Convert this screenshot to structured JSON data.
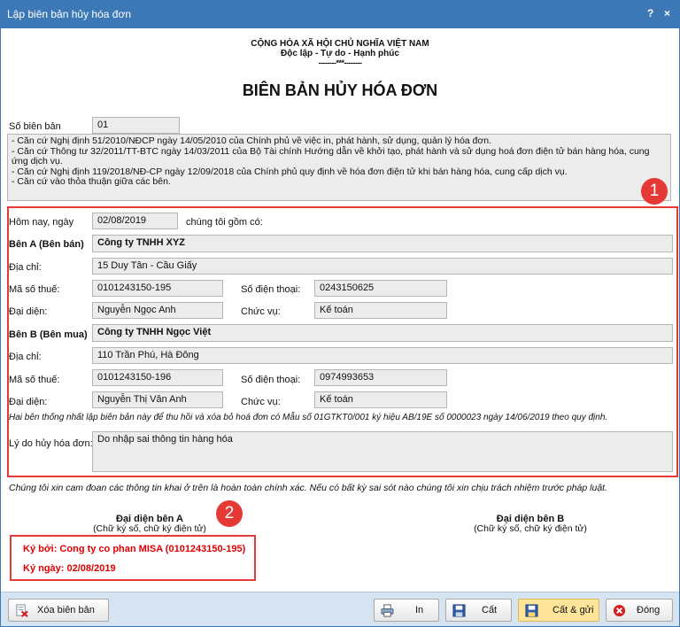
{
  "window": {
    "title": "Lập biên bản hủy hóa đơn",
    "help": "?",
    "close": "×"
  },
  "header": {
    "line1": "CỘNG HÒA XÃ HỘI CHỦ NGHĨA VIỆT NAM",
    "line2": "Độc lập - Tự do - Hạnh phúc",
    "line3": "--------***--------",
    "title": "BIÊN BẢN HỦY HÓA ĐƠN"
  },
  "so_bien_ban": {
    "label": "Số biên bản",
    "value": "01"
  },
  "legal_basis": [
    "- Căn cứ Nghị định 51/2010/NĐCP ngày 14/05/2010 của Chính phủ về việc in, phát hành, sử dụng, quản lý hóa đơn.",
    "- Căn cứ Thông tư 32/2011/TT-BTC ngày 14/03/2011 của Bộ Tài chính Hướng dẫn về khởi tạo, phát hành và sử dụng hoá đơn điện tử bán hàng hóa, cung ứng dịch vụ.",
    "- Căn cứ Nghị định 119/2018/NĐ-CP ngày 12/09/2018 của Chính phủ quy định về hóa đơn điện tử khi bán hàng hóa, cung cấp dịch vụ.",
    "- Căn cứ vào thỏa thuận giữa các bên."
  ],
  "badges": {
    "one": "1",
    "two": "2"
  },
  "today": {
    "label": "Hôm nay, ngày",
    "value": "02/08/2019",
    "suffix": "chúng tôi gồm có:"
  },
  "party_a": {
    "label": "Bên A (Bên bán)",
    "name": "Công ty TNHH XYZ",
    "address_label": "Địa chỉ:",
    "address": "15 Duy Tân - Cầu Giấy",
    "tax_label": "Mã số thuế:",
    "tax": "0101243150-195",
    "phone_label": "Số điện thoại:",
    "phone": "0243150625",
    "rep_label": "Đại diện:",
    "rep": "Nguyễn Ngọc Anh",
    "pos_label": "Chức vụ:",
    "pos": "Kế toán"
  },
  "party_b": {
    "label": "Bên B (Bên mua)",
    "name": "Công ty TNHH Ngọc Việt",
    "address_label": "Địa chỉ:",
    "address": "110 Trần Phú, Hà Đông",
    "tax_label": "Mã số thuế:",
    "tax": "0101243150-196",
    "phone_label": "Số điện thoại:",
    "phone": "0974993653",
    "rep_label": "Đại diện:",
    "rep": "Nguyễn Thị Vân Anh",
    "pos_label": "Chức vụ:",
    "pos": "Kế toán"
  },
  "agreement": "Hai bên thống nhất lập biên bản này để thu hồi và xóa bỏ hoá đơn có Mẫu số 01GTKT0/001 ký hiệu AB/19E số 0000023 ngày 14/06/2019 theo quy định.",
  "reason": {
    "label": "Lý do hủy hóa đơn:",
    "value": "Do nhập sai thông tin hàng hóa"
  },
  "commitment": "Chúng tôi xin cam đoan các thông tin khai ở trên là hoàn toàn chính xác. Nếu có bất kỳ sai sót nào chúng tôi xin chịu trách nhiệm trước pháp luật.",
  "sign_a": {
    "title": "Đại diện bên A",
    "subtitle": "(Chữ ký số, chữ ký điện tử)",
    "signed_by": "Ký bởi: Cong ty co phan MISA (0101243150-195)",
    "signed_date": "Ký ngày: 02/08/2019"
  },
  "sign_b": {
    "title": "Đại diện bên B",
    "subtitle": "(Chữ ký số, chữ ký điện tử)"
  },
  "buttons": {
    "delete": "Xóa biên bản",
    "print": "In",
    "save": "Cất",
    "save_send": "Cất & gửi",
    "close": "Đóng"
  }
}
